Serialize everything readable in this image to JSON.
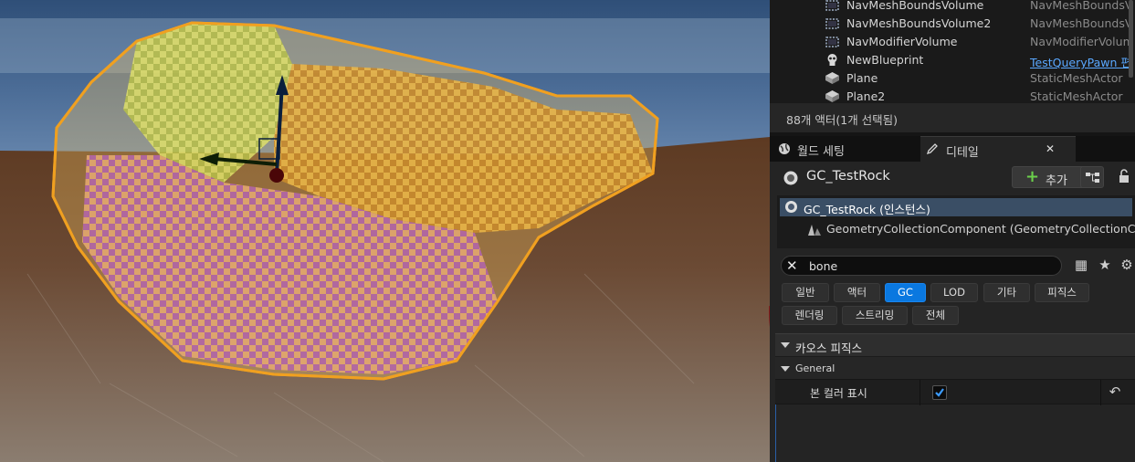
{
  "outliner": {
    "rows": [
      {
        "name": "NavMeshBoundsVolume",
        "type": "NavMeshBoundsV",
        "icon": "volume-icon"
      },
      {
        "name": "NavMeshBoundsVolume2",
        "type": "NavMeshBoundsV",
        "icon": "volume-icon"
      },
      {
        "name": "NavModifierVolume",
        "type": "NavModifierVolum",
        "icon": "volume-icon"
      },
      {
        "name": "NewBlueprint",
        "type": "TestQueryPawn 편",
        "icon": "skull-icon",
        "type_is_link": true
      },
      {
        "name": "Plane",
        "type": "StaticMeshActor",
        "icon": "static-mesh-icon"
      },
      {
        "name": "Plane2",
        "type": "StaticMeshActor",
        "icon": "static-mesh-icon"
      }
    ],
    "count_text": "88개 액터(1개 선택됨)"
  },
  "tabs": {
    "world_settings": "월드 세팅",
    "details": "디테일",
    "close": "✕"
  },
  "details": {
    "actor_name": "GC_TestRock",
    "add_button": "추가",
    "components": {
      "selected": "GC_TestRock (인스턴스)",
      "child": "GeometryCollectionComponent (GeometryCollectionCompo"
    },
    "search": {
      "value": "bone",
      "placeholder": ""
    },
    "filters_row1": [
      "일반",
      "액터",
      "GC",
      "LOD",
      "기타",
      "피직스"
    ],
    "filters_row2": [
      "렌더링",
      "스트리밍",
      "전체"
    ],
    "active_filter": "GC",
    "section": "카오스 피직스",
    "subsection": "General",
    "property": {
      "label": "본 컬러 표시",
      "checked": true
    }
  },
  "colors": {
    "accent": "#0a78e0",
    "selection": "#3a4e65",
    "link": "#5aa8ff",
    "annotation": "#8b1818"
  }
}
